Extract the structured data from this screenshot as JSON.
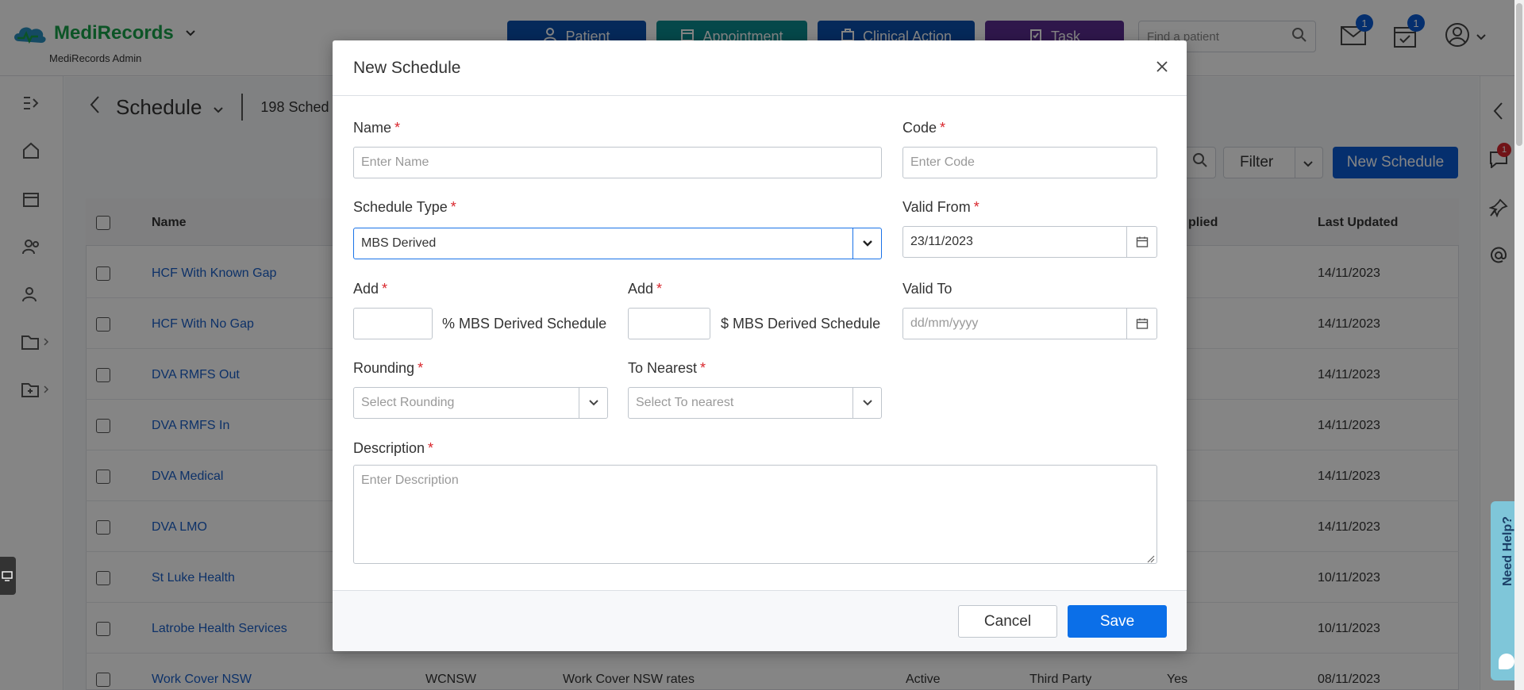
{
  "header": {
    "logo": "MediRecords",
    "subtitle": "MediRecords Admin",
    "buttons": {
      "patient": "Patient",
      "appointment": "Appointment",
      "clinical_action": "Clinical Action",
      "task": "Task"
    },
    "search_placeholder": "Find a patient",
    "mail_badge": "1",
    "tasks_badge": "1",
    "colors": {
      "patient": "#0b4fad",
      "appointment": "#0b8a8f",
      "clinical_action": "#0b4fad",
      "task": "#5a2d91"
    }
  },
  "page": {
    "title": "Schedule",
    "count_text": "198 Sched",
    "filter_label": "Filter",
    "new_schedule_label": "New Schedule"
  },
  "table": {
    "columns": {
      "name": "Name",
      "applied": "plied",
      "updated": "Last Updated"
    },
    "rows": [
      {
        "name": "HCF With Known Gap",
        "code": "",
        "description": "",
        "status": "",
        "type": "",
        "applied": "",
        "updated": "14/11/2023"
      },
      {
        "name": "HCF With No Gap",
        "code": "",
        "description": "",
        "status": "",
        "type": "",
        "applied": "",
        "updated": "14/11/2023"
      },
      {
        "name": "DVA RMFS Out",
        "code": "",
        "description": "",
        "status": "",
        "type": "",
        "applied": "",
        "updated": "14/11/2023"
      },
      {
        "name": "DVA RMFS In",
        "code": "",
        "description": "",
        "status": "",
        "type": "",
        "applied": "",
        "updated": "14/11/2023"
      },
      {
        "name": "DVA Medical",
        "code": "",
        "description": "",
        "status": "",
        "type": "",
        "applied": "",
        "updated": "14/11/2023"
      },
      {
        "name": "DVA LMO",
        "code": "",
        "description": "",
        "status": "",
        "type": "",
        "applied": "",
        "updated": "14/11/2023"
      },
      {
        "name": "St Luke Health",
        "code": "",
        "description": "",
        "status": "",
        "type": "",
        "applied": "",
        "updated": "10/11/2023"
      },
      {
        "name": "Latrobe Health Services",
        "code": "",
        "description": "",
        "status": "",
        "type": "",
        "applied": "",
        "updated": "10/11/2023"
      },
      {
        "name": "Work Cover NSW",
        "code": "WCNSW",
        "description": "Work Cover NSW rates",
        "status": "Active",
        "type": "Third Party",
        "applied": "Yes",
        "updated": "08/11/2023"
      }
    ]
  },
  "modal": {
    "title": "New Schedule",
    "name": {
      "label": "Name",
      "placeholder": "Enter Name",
      "value": ""
    },
    "code": {
      "label": "Code",
      "placeholder": "Enter Code",
      "value": ""
    },
    "schedule_type": {
      "label": "Schedule Type",
      "value": "MBS Derived"
    },
    "valid_from": {
      "label": "Valid From",
      "value": "23/11/2023"
    },
    "add_percent": {
      "label": "Add",
      "suffix": "% MBS Derived Schedule",
      "value": ""
    },
    "add_dollar": {
      "label": "Add",
      "suffix": "$ MBS Derived Schedule",
      "value": ""
    },
    "valid_to": {
      "label": "Valid To",
      "placeholder": "dd/mm/yyyy"
    },
    "rounding": {
      "label": "Rounding",
      "placeholder": "Select Rounding"
    },
    "to_nearest": {
      "label": "To Nearest",
      "placeholder": "Select To nearest"
    },
    "description": {
      "label": "Description",
      "placeholder": "Enter Description"
    },
    "cancel_label": "Cancel",
    "save_label": "Save",
    "required_mark": "*"
  },
  "right_panel": {
    "notification_badge": "1",
    "help_label": "Need Help?"
  }
}
